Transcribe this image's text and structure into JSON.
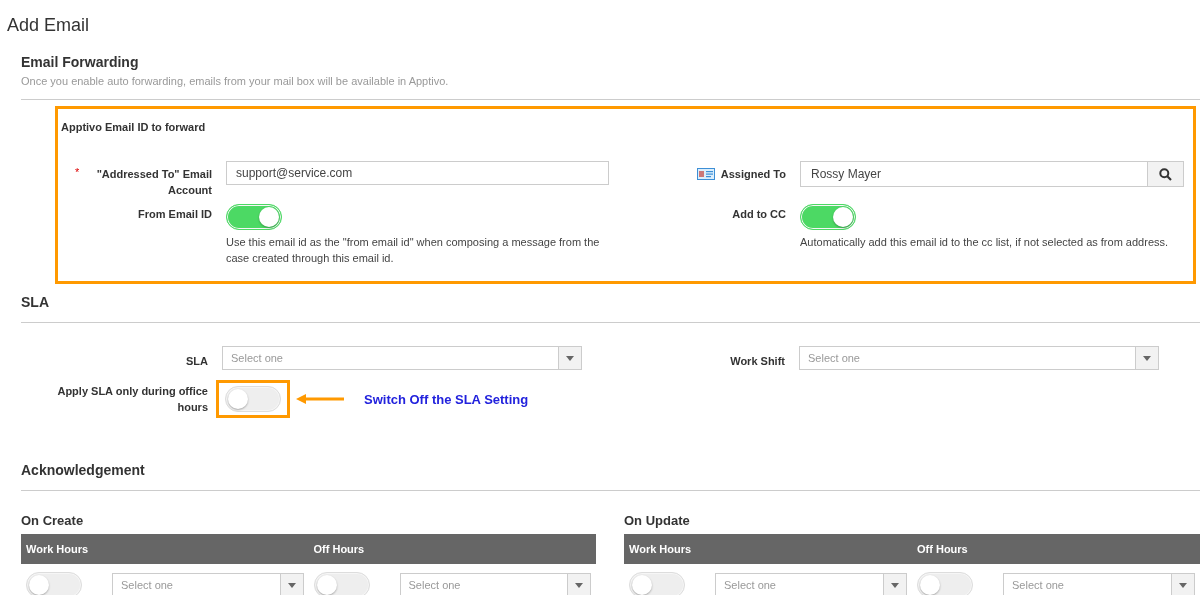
{
  "page_title": "Add Email",
  "email_forwarding": {
    "heading": "Email Forwarding",
    "description": "Once you enable auto forwarding, emails from your mail box will be available in Apptivo.",
    "highlight": {
      "heading": "Apptivo Email ID to forward",
      "addressed_to": {
        "required_mark": "*",
        "label": "\"Addressed To\" Email Account",
        "value": "support@service.com"
      },
      "assigned_to": {
        "label": "Assigned To",
        "value": "Rossy Mayer"
      },
      "from_email_id": {
        "label": "From Email ID",
        "on": true,
        "help": "Use this email id as the \"from email id\" when composing a message from the case created through this email id."
      },
      "add_to_cc": {
        "label": "Add to CC",
        "on": true,
        "help": "Automatically add this email id to the cc list, if not selected as from address."
      }
    }
  },
  "sla": {
    "heading": "SLA",
    "sla_select": {
      "label": "SLA",
      "placeholder": "Select one"
    },
    "work_shift": {
      "label": "Work Shift",
      "placeholder": "Select one"
    },
    "office_hours": {
      "label": "Apply SLA only during office hours",
      "on": false
    },
    "callout": "Switch Off the SLA Setting"
  },
  "acknowledgement": {
    "heading": "Acknowledgement",
    "groups": [
      {
        "title": "On Create",
        "columns": [
          {
            "label": "Work Hours",
            "on": false,
            "placeholder": "Select one"
          },
          {
            "label": "Off Hours",
            "on": false,
            "placeholder": "Select one"
          }
        ]
      },
      {
        "title": "On Update",
        "columns": [
          {
            "label": "Work Hours",
            "on": false,
            "placeholder": "Select one"
          },
          {
            "label": "Off Hours",
            "on": false,
            "placeholder": "Select one"
          }
        ]
      }
    ]
  }
}
